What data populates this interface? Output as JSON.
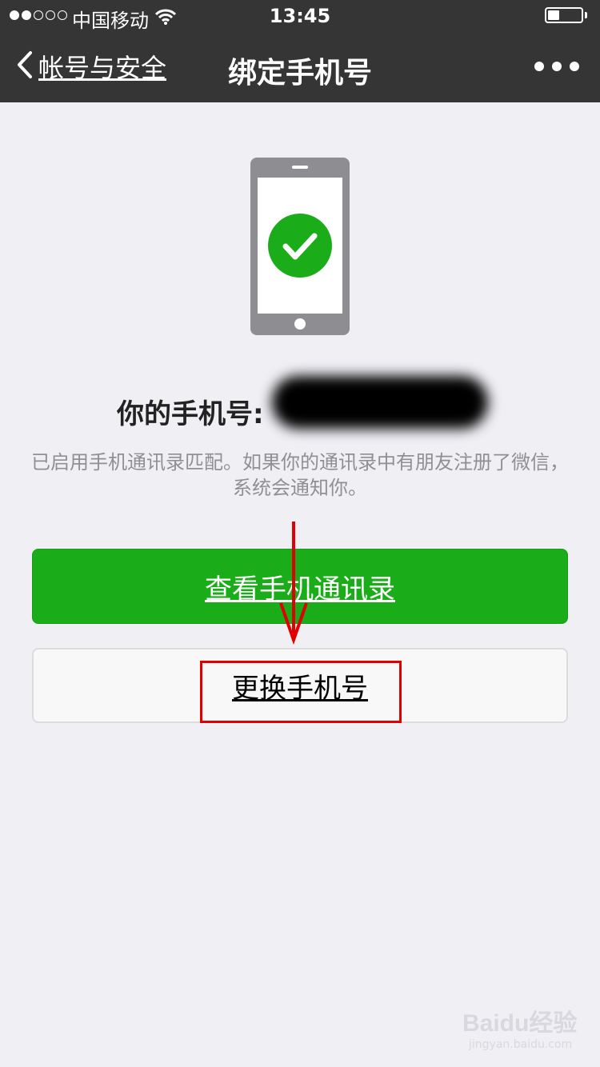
{
  "status_bar": {
    "carrier": "中国移动",
    "time": "13:45",
    "signal_filled": 2,
    "signal_total": 5,
    "battery_level": 0.35
  },
  "nav": {
    "back_label": "帐号与安全",
    "title": "绑定手机号",
    "back_icon": "chevron-left-icon",
    "more_icon": "more-dots-icon"
  },
  "illustration": {
    "icon": "phone-check-icon",
    "check_color": "#1aad19"
  },
  "phone_number": {
    "label": "你的手机号:"
  },
  "description": "已启用手机通讯录匹配。如果你的通讯录中有朋友注册了微信，系统会通知你。",
  "buttons": {
    "view_contacts": "查看手机通讯录",
    "change_number": "更换手机号"
  },
  "colors": {
    "header_bg": "#353536",
    "primary_green": "#1aad19",
    "annotation_red": "#e00000",
    "page_bg": "#efeff4"
  },
  "watermark": {
    "main": "Baidu经验",
    "sub": "jingyan.baidu.com"
  }
}
